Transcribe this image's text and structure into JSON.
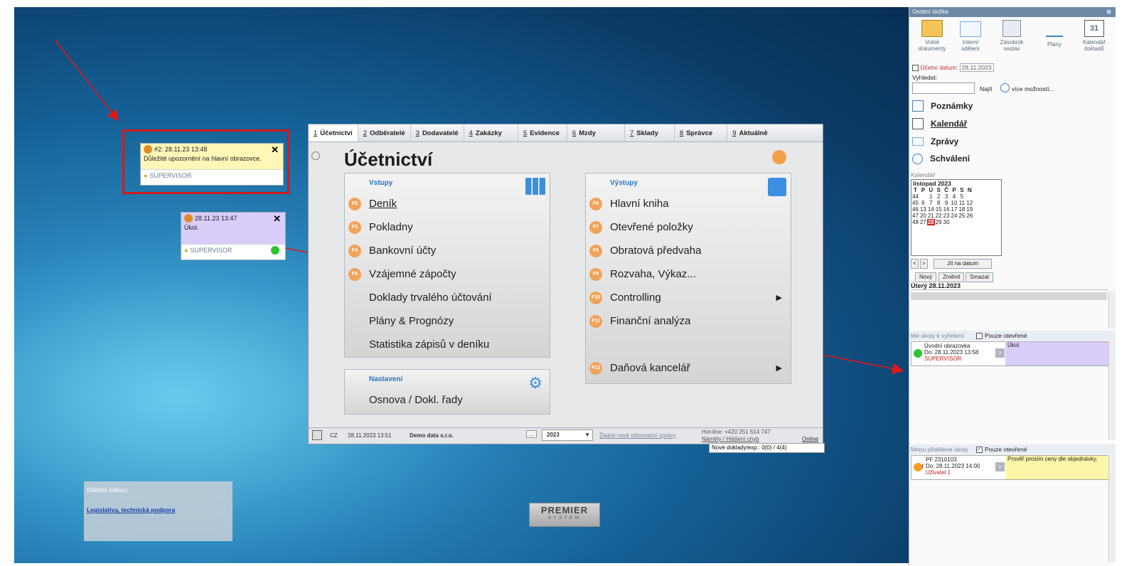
{
  "note1": {
    "header": "#2: 28.11.23 13:48",
    "body": "Důležité upozornění na hlavní obrazovce.",
    "user": "SUPERVISOR"
  },
  "note2": {
    "header": "28.11.23 13:47",
    "body": "Úkol.",
    "user": "SUPERVISOR"
  },
  "tabs": [
    {
      "num": "1",
      "label": "Účetnictví"
    },
    {
      "num": "2",
      "label": "Odběratelé"
    },
    {
      "num": "3",
      "label": "Dodavatelé"
    },
    {
      "num": "4",
      "label": "Zakázky"
    },
    {
      "num": "5",
      "label": "Evidence"
    },
    {
      "num": "6",
      "label": "Mzdy"
    },
    {
      "num": "7",
      "label": "Sklady"
    },
    {
      "num": "8",
      "label": "Správce"
    },
    {
      "num": "9",
      "label": "Aktuálně"
    }
  ],
  "window_title": "Účetnictví",
  "vstupy": {
    "header": "Vstupy",
    "items": [
      {
        "key": "F2",
        "label": "Deník"
      },
      {
        "key": "F3",
        "label": "Pokladny"
      },
      {
        "key": "F4",
        "label": "Bankovní účty"
      },
      {
        "key": "F5",
        "label": "Vzájemné zápočty"
      },
      {
        "key": "",
        "label": "Doklady trvalého účtování"
      },
      {
        "key": "",
        "label": "Plány & Prognózy"
      },
      {
        "key": "",
        "label": "Statistika zápisů v deníku"
      }
    ]
  },
  "vystupy": {
    "header": "Výstupy",
    "items": [
      {
        "key": "F6",
        "label": "Hlavní kniha"
      },
      {
        "key": "F7",
        "label": "Otevřené položky"
      },
      {
        "key": "F8",
        "label": "Obratová předvaha"
      },
      {
        "key": "F9",
        "label": "Rozvaha, Výkaz..."
      },
      {
        "key": "F10",
        "label": "Controlling"
      },
      {
        "key": "F11",
        "label": "Finanční analýza"
      },
      {
        "key": "F12",
        "label": "Daňová kancelář"
      }
    ]
  },
  "nastaveni": {
    "header": "Nastavení",
    "item": "Osnova / Dokl. řady"
  },
  "status": {
    "lang": "CZ",
    "datetime": "28.11.2023 13:51",
    "company": "Demo data s.r.o.",
    "dots": "...",
    "year": "2023",
    "info": "Žádné nové informační zprávy",
    "hotline": "Hot-line: +420 251 614 747",
    "ideas": "Náměty / Hlášení chyb",
    "online": "Online",
    "new_docs_label": "Nové doklady/exp.:",
    "new_docs_value": "0(0) / 4(4)"
  },
  "links_box": {
    "title": "Důležité odkazy:",
    "link": "Legislativa, technická podpora"
  },
  "logo": {
    "line1": "PREMIER",
    "line2": "SYSTEM"
  },
  "right_panel": {
    "title": "Osobní složka",
    "toolbar": [
      {
        "label1": "Volné",
        "label2": "dokumenty"
      },
      {
        "label1": "Interní",
        "label2": "sdělení"
      },
      {
        "label1": "Zásobník",
        "label2": "sestav"
      },
      {
        "label1": "Plány",
        "label2": ""
      },
      {
        "label1": "Kalendář",
        "label2": "dokladů"
      }
    ],
    "ucetni_datum_label": "Účetní datum:",
    "ucetni_datum": "28.11.2023",
    "vyhledat_label": "Vyhledat:",
    "najit": "Najít",
    "vice": "více možností...",
    "nav": [
      "Poznámky",
      "Kalendář",
      "Zprávy",
      "Schválení"
    ],
    "kalendar_label": "Kalendář",
    "month": "listopad 2023",
    "weekdays": [
      "T",
      "P",
      "Ú",
      "S",
      "Č",
      "P",
      "S",
      "N"
    ],
    "weeks": [
      [
        "44",
        "",
        "1",
        "2",
        "3",
        "4",
        "5"
      ],
      [
        "45",
        "6",
        "7",
        "8",
        "9",
        "10",
        "11",
        "12"
      ],
      [
        "46",
        "13",
        "14",
        "15",
        "16",
        "17",
        "18",
        "19"
      ],
      [
        "47",
        "20",
        "21",
        "22",
        "23",
        "24",
        "25",
        "26"
      ],
      [
        "48",
        "27",
        "28",
        "29",
        "30",
        "",
        "",
        ""
      ]
    ],
    "prev": "<",
    "next": ">",
    "jit": "Jít na datum",
    "novy": "Nový",
    "zmenit": "Změnit",
    "smazat": "Smazat",
    "day_header": "Úterý 28.11.2023",
    "my_tasks_label": "Mé úkoly k vyřešení",
    "only_open": "Pouze otevřené",
    "task1": {
      "title": "Úvodní obrazovka",
      "do": "Do: 28.11.2023 13:58",
      "user": "SUPERVISOR",
      "text": "Úkol."
    },
    "assigned_label": "Mnou přidělené úkoly",
    "only_open2": "Pouze otevřené",
    "task2": {
      "title": "PF 2310103",
      "do": "Do: 28.11.2023 14:00",
      "user": "Uživatel 1",
      "text": "Prověř prosím ceny dle objednávky."
    }
  }
}
